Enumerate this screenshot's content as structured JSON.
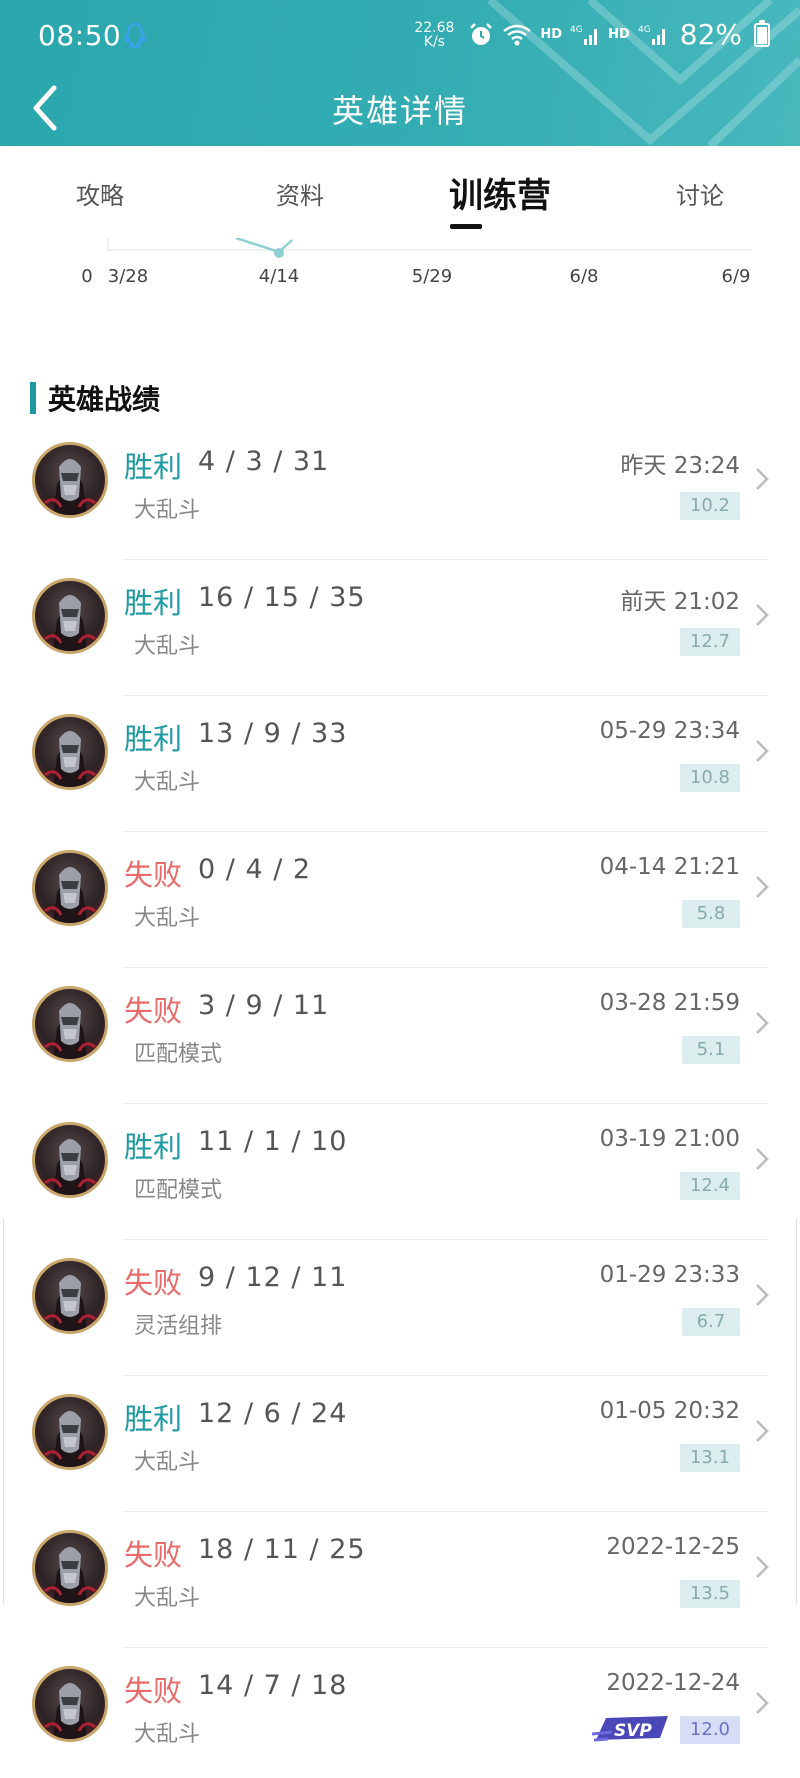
{
  "status_bar": {
    "time": "08:50",
    "net_speed_value": "22.68",
    "net_speed_unit": "K/s",
    "signal_labels": [
      "HD",
      "4G",
      "HD",
      "4G"
    ],
    "battery": "82%"
  },
  "header": {
    "title": "英雄详情"
  },
  "tabs": [
    {
      "label": "攻略",
      "active": false
    },
    {
      "label": "资料",
      "active": false
    },
    {
      "label": "训练营",
      "active": true
    },
    {
      "label": "讨论",
      "active": false
    }
  ],
  "chart_data": {
    "type": "line",
    "x": [
      "0",
      "3/28",
      "4/14",
      "5/29",
      "6/8",
      "6/9"
    ],
    "note_visible": "chart mostly scrolled off; only x tick labels and a fragment of line visible"
  },
  "section": {
    "title": "英雄战绩"
  },
  "records": [
    {
      "result": "胜利",
      "outcome": "win",
      "kda": "4 / 3 / 31",
      "mode": "大乱斗",
      "time": "昨天 23:24",
      "score": "10.2",
      "svp": false
    },
    {
      "result": "胜利",
      "outcome": "win",
      "kda": "16 / 15 / 35",
      "mode": "大乱斗",
      "time": "前天 21:02",
      "score": "12.7",
      "svp": false
    },
    {
      "result": "胜利",
      "outcome": "win",
      "kda": "13 / 9 / 33",
      "mode": "大乱斗",
      "time": "05-29 23:34",
      "score": "10.8",
      "svp": false
    },
    {
      "result": "失败",
      "outcome": "lose",
      "kda": "0 / 4 / 2",
      "mode": "大乱斗",
      "time": "04-14 21:21",
      "score": "5.8",
      "svp": false
    },
    {
      "result": "失败",
      "outcome": "lose",
      "kda": "3 / 9 / 11",
      "mode": "匹配模式",
      "time": "03-28 21:59",
      "score": "5.1",
      "svp": false
    },
    {
      "result": "胜利",
      "outcome": "win",
      "kda": "11 / 1 / 10",
      "mode": "匹配模式",
      "time": "03-19 21:00",
      "score": "12.4",
      "svp": false
    },
    {
      "result": "失败",
      "outcome": "lose",
      "kda": "9 / 12 / 11",
      "mode": "灵活组排",
      "time": "01-29 23:33",
      "score": "6.7",
      "svp": false
    },
    {
      "result": "胜利",
      "outcome": "win",
      "kda": "12 / 6 / 24",
      "mode": "大乱斗",
      "time": "01-05 20:32",
      "score": "13.1",
      "svp": false
    },
    {
      "result": "失败",
      "outcome": "lose",
      "kda": "18 / 11 / 25",
      "mode": "大乱斗",
      "time": "2022-12-25",
      "score": "13.5",
      "svp": false
    },
    {
      "result": "失败",
      "outcome": "lose",
      "kda": "14 / 7 / 18",
      "mode": "大乱斗",
      "time": "2022-12-24",
      "score": "12.0",
      "svp": true,
      "svp_label": "SVP"
    }
  ],
  "colors": {
    "accent": "#1e9aa3",
    "win": "#1e9aa3",
    "lose": "#e86a6a",
    "header": "#2aa6ad"
  }
}
